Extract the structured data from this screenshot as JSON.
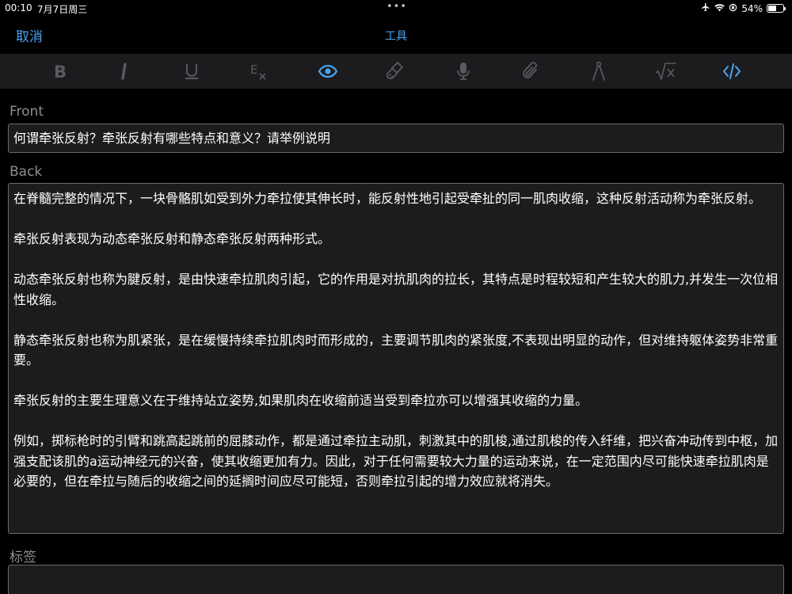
{
  "status_bar": {
    "time": "00:10",
    "date": "7月7日周三",
    "dots": "•••",
    "battery_percent": "54%",
    "battery_level": 0.54
  },
  "nav": {
    "cancel_label": "取消",
    "title": "工具"
  },
  "toolbar": {
    "buttons": [
      "bold-icon",
      "italic-icon",
      "underline-icon",
      "clear-format-icon",
      "eye-icon",
      "paintbrush-icon",
      "microphone-icon",
      "paperclip-icon",
      "compass-icon",
      "square-root-icon",
      "code-icon"
    ],
    "active": [
      "eye-icon",
      "code-icon"
    ],
    "accent_color": "#4aa3f0",
    "inactive_color": "#5a5a5e"
  },
  "front": {
    "label": "Front",
    "value": "何谓牵张反射？牵张反射有哪些特点和意义？请举例说明"
  },
  "back": {
    "label": "Back",
    "paragraphs": [
      "在脊髓完整的情况下，一块骨骼肌如受到外力牵拉使其伸长时，能反射性地引起受牵扯的同一肌肉收缩，这种反射活动称为牵张反射。",
      "牵张反射表现为动态牵张反射和静态牵张反射两种形式。",
      "动态牵张反射也称为腱反射，是由快速牵拉肌肉引起，它的作用是对抗肌肉的拉长，其特点是时程较短和产生较大的肌力,并发生一次位相性收缩。",
      "静态牵张反射也称为肌紧张，是在缓慢持续牵拉肌肉时而形成的，主要调节肌肉的紧张度,不表现出明显的动作，但对维持躯体姿势非常重要。",
      "牵张反射的主要生理意义在于维持站立姿势,如果肌肉在收缩前适当受到牵拉亦可以增强其收缩的力量。",
      "例如，掷标枪时的引臂和跳高起跳前的屈膝动作，都是通过牵拉主动肌，刺激其中的肌梭,通过肌梭的传入纤维，把兴奋冲动传到中枢，加强支配该肌的a运动神经元的兴奋，使其收缩更加有力。因此，对于任何需要较大力量的运动来说，在一定范围内尽可能快速牵拉肌肉是必要的，但在牵拉与随后的收缩之间的延搁时间应尽可能短，否则牵拉引起的增力效应就将消失。"
    ]
  },
  "tags": {
    "label": "标签",
    "value": ""
  }
}
